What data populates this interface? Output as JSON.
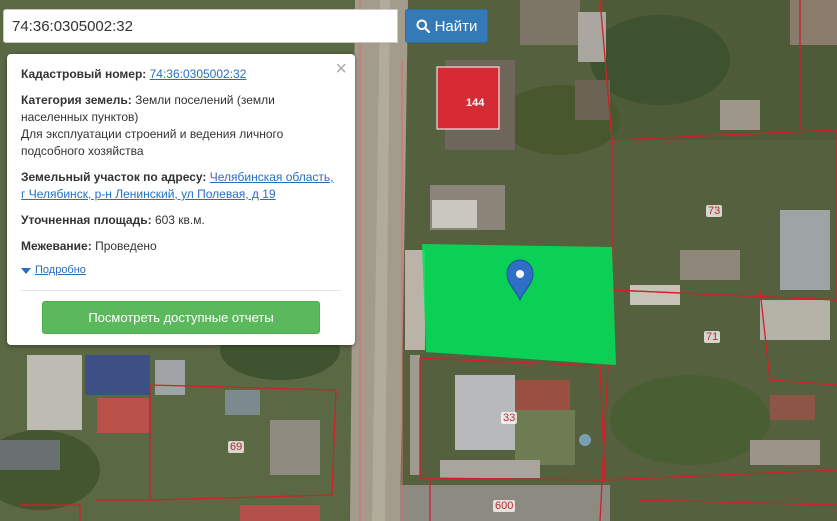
{
  "search": {
    "value": "74:36:0305002:32",
    "button_label": "Найти"
  },
  "panel": {
    "cad_label": "Кадастровый номер:",
    "cad_value": "74:36:0305002:32",
    "category_label": "Категория земель:",
    "category_value": "Земли поселений (земли населенных пунктов)",
    "usage": "Для эксплуатации строений и ведения личного подсобного хозяйства",
    "address_label": "Земельный участок по адресу:",
    "address_value": "Челябинская область, г Челябинск, р-н Ленинский, ул Полевая, д 19",
    "area_label": "Уточненная площадь:",
    "area_value": "603 кв.м.",
    "survey_label": "Межевание:",
    "survey_value": "Проведено",
    "more_label": "Подробно",
    "report_button": "Посмотреть доступные отчеты",
    "close_symbol": "×"
  },
  "map": {
    "lot_labels": [
      {
        "id": "144",
        "text": "144"
      },
      {
        "id": "73",
        "text": "73"
      },
      {
        "id": "71",
        "text": "71"
      },
      {
        "id": "33",
        "text": "33"
      },
      {
        "id": "69",
        "text": "69"
      },
      {
        "id": "600",
        "text": "600"
      }
    ],
    "highlight_color": "#00e05a",
    "boundary_color": "#d2202a",
    "building_highlight_color": "#d62b34"
  }
}
